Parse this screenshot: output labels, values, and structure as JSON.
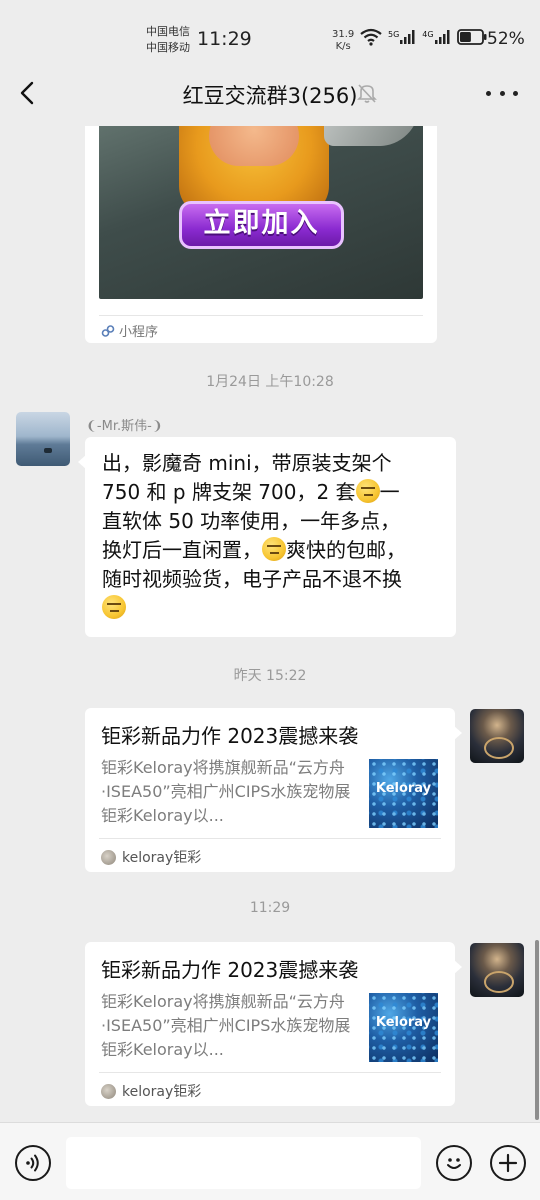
{
  "status_bar": {
    "carrier_1": "中国电信",
    "carrier_2": "中国移动",
    "time": "11:29",
    "net_speed_value": "31.9",
    "net_speed_unit": "K/s",
    "signal_1_label": "5G",
    "signal_2_label": "4G",
    "battery_percent": "52%",
    "battery_level": 0.52
  },
  "header": {
    "title": "红豆交流群3(256)",
    "back_icon": "chevron-left-icon",
    "mute_icon": "bell-off-icon",
    "more_icon": "more-icon"
  },
  "messages": {
    "mini_program": {
      "button_text": "立即加入",
      "source_label": "小程序"
    },
    "time_1": "1月24日 上午10:28",
    "sender_name": "-Mr.斯伟-",
    "text_message": {
      "line_1": "出，影魔奇 mini，带原装支架个",
      "line_2a": "750 和 p 牌支架 700，2 套",
      "line_2b": "一",
      "line_3": "直软体 50 功率使用，一年多点，",
      "line_4a": "换灯后一直闲置，",
      "line_4b": "爽快的包邮，",
      "line_5": "随时视频验货，电子产品不退不换"
    },
    "time_2": "昨天 15:22",
    "link_1": {
      "title": "钜彩新品力作 2023震撼来袭",
      "description": "钜彩Keloray将携旗舰新品“云方舟·ISEA50”亮相广州CIPS水族宠物展钜彩Keloray以...",
      "thumb_text": "Keloray",
      "source": "keloray钜彩"
    },
    "time_3": "11:29",
    "link_2": {
      "title": "钜彩新品力作 2023震撼来袭",
      "description": "钜彩Keloray将携旗舰新品“云方舟·ISEA50”亮相广州CIPS水族宠物展钜彩Keloray以...",
      "thumb_text": "Keloray",
      "source": "keloray钜彩"
    }
  },
  "input_bar": {
    "voice_icon": "voice-icon",
    "emoji_icon": "emoji-icon",
    "plus_icon": "plus-icon",
    "input_value": ""
  },
  "colors": {
    "background": "#ededed",
    "bubble": "#ffffff",
    "timestamp": "#9a9a9a"
  }
}
